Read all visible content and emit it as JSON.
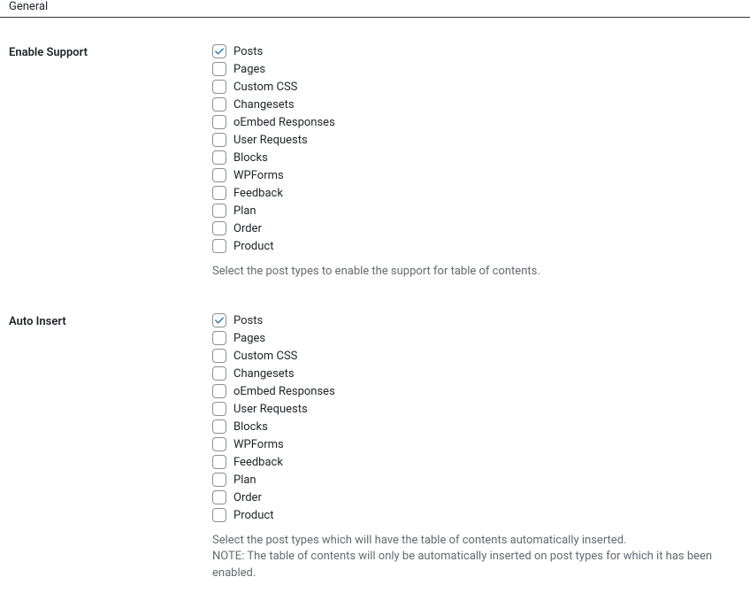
{
  "section_header": "General",
  "rows": [
    {
      "label": "Enable Support",
      "options": [
        {
          "label": "Posts",
          "checked": true
        },
        {
          "label": "Pages",
          "checked": false
        },
        {
          "label": "Custom CSS",
          "checked": false
        },
        {
          "label": "Changesets",
          "checked": false
        },
        {
          "label": "oEmbed Responses",
          "checked": false
        },
        {
          "label": "User Requests",
          "checked": false
        },
        {
          "label": "Blocks",
          "checked": false
        },
        {
          "label": "WPForms",
          "checked": false
        },
        {
          "label": "Feedback",
          "checked": false
        },
        {
          "label": "Plan",
          "checked": false
        },
        {
          "label": "Order",
          "checked": false
        },
        {
          "label": "Product",
          "checked": false
        }
      ],
      "description": "Select the post types to enable the support for table of contents."
    },
    {
      "label": "Auto Insert",
      "options": [
        {
          "label": "Posts",
          "checked": true
        },
        {
          "label": "Pages",
          "checked": false
        },
        {
          "label": "Custom CSS",
          "checked": false
        },
        {
          "label": "Changesets",
          "checked": false
        },
        {
          "label": "oEmbed Responses",
          "checked": false
        },
        {
          "label": "User Requests",
          "checked": false
        },
        {
          "label": "Blocks",
          "checked": false
        },
        {
          "label": "WPForms",
          "checked": false
        },
        {
          "label": "Feedback",
          "checked": false
        },
        {
          "label": "Plan",
          "checked": false
        },
        {
          "label": "Order",
          "checked": false
        },
        {
          "label": "Product",
          "checked": false
        }
      ],
      "description": "Select the post types which will have the table of contents automatically inserted.",
      "note_prefix": "NOTE:",
      "note": " The table of contents will only be automatically inserted on post types for which it has been enabled."
    }
  ]
}
